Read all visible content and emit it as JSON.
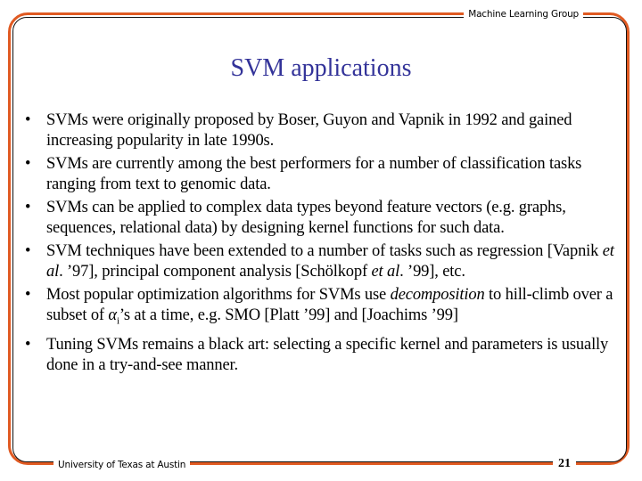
{
  "header": {
    "group_label": "Machine Learning Group"
  },
  "slide": {
    "title": "SVM applications",
    "bullets": [
      {
        "parts": [
          {
            "text": "SVMs were originally proposed by Boser, Guyon and Vapnik in 1992 and gained increasing popularity in late 1990s."
          }
        ]
      },
      {
        "parts": [
          {
            "text": "SVMs are currently among the best performers for a number of classification tasks ranging from text to genomic data."
          }
        ]
      },
      {
        "parts": [
          {
            "text": "SVMs can be applied to complex data types beyond feature vectors (e.g. graphs, sequences, relational data) by designing kernel functions for such data."
          }
        ]
      },
      {
        "parts": [
          {
            "text": "SVM techniques have been extended to a number of tasks such as regression [Vapnik "
          },
          {
            "text": "et al",
            "italic": true
          },
          {
            "text": ". ’97], principal component analysis [Schölkopf "
          },
          {
            "text": "et al",
            "italic": true
          },
          {
            "text": ". ’99], etc."
          }
        ]
      },
      {
        "parts": [
          {
            "text": "Most popular optimization algorithms for SVMs use "
          },
          {
            "text": "decomposition",
            "italic": true
          },
          {
            "text": " to hill-climb over a subset of "
          },
          {
            "text": "α",
            "italic": true
          },
          {
            "text": "i",
            "sub": true
          },
          {
            "text": "’s at a time, e.g. SMO [Platt ’99] and  [Joachims ’99]"
          }
        ]
      },
      {
        "parts": [
          {
            "text": " Tuning SVMs remains a black art:  selecting a specific kernel and parameters is usually done in a try-and-see manner."
          }
        ]
      }
    ],
    "bullet_glyph": "•"
  },
  "footer": {
    "institution": "University of Texas at Austin",
    "page_number": "21"
  },
  "colors": {
    "frame_orange": "#e05a22",
    "title_blue": "#333399"
  }
}
